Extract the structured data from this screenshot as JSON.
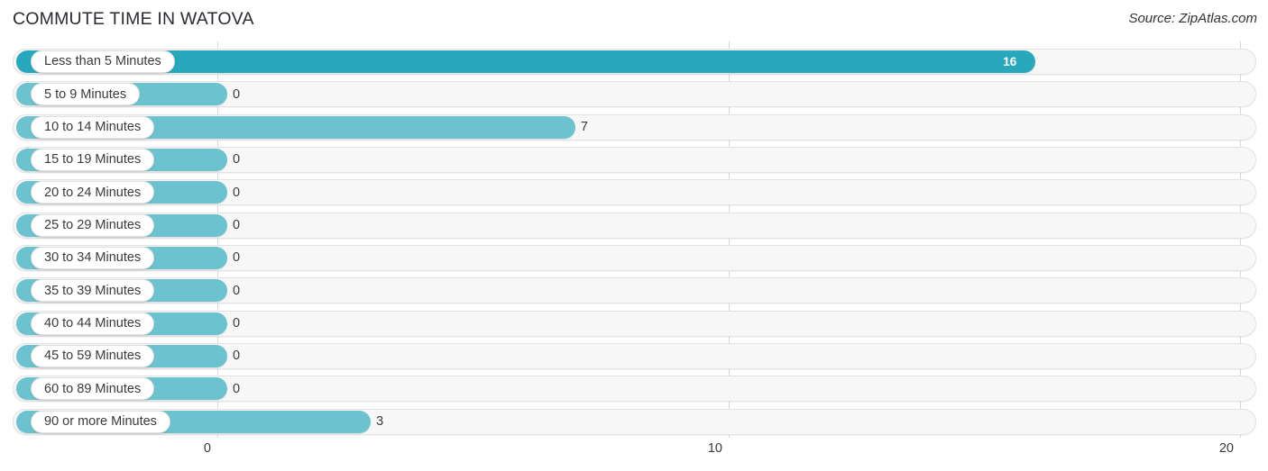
{
  "header": {
    "title": "COMMUTE TIME IN WATOVA",
    "source": "Source: ZipAtlas.com"
  },
  "colors": {
    "bar_highlight": "#29a8bc",
    "bar_normal": "#6cc2ce",
    "track_fill": "#f7f7f7",
    "track_border": "#e3e3e3",
    "gridline": "#d8d8d8",
    "label_text": "#3a3a3a",
    "value_inside_text": "#ffffff"
  },
  "chart_data": {
    "type": "bar",
    "orientation": "horizontal",
    "title": "COMMUTE TIME IN WATOVA",
    "subtitle": "",
    "xlabel": "",
    "ylabel": "",
    "xlim": [
      0,
      20
    ],
    "grid": true,
    "legend": "none",
    "ticks": [
      {
        "label": "0",
        "value": 0
      },
      {
        "label": "10",
        "value": 10
      },
      {
        "label": "20",
        "value": 20
      }
    ],
    "categories": [
      "Less than 5 Minutes",
      "5 to 9 Minutes",
      "10 to 14 Minutes",
      "15 to 19 Minutes",
      "20 to 24 Minutes",
      "25 to 29 Minutes",
      "30 to 34 Minutes",
      "35 to 39 Minutes",
      "40 to 44 Minutes",
      "45 to 59 Minutes",
      "60 to 89 Minutes",
      "90 or more Minutes"
    ],
    "values": [
      16,
      0,
      7,
      0,
      0,
      0,
      0,
      0,
      0,
      0,
      0,
      3
    ],
    "value_labels": [
      "16",
      "0",
      "7",
      "0",
      "0",
      "0",
      "0",
      "0",
      "0",
      "0",
      "0",
      "3"
    ]
  },
  "rows": [
    {
      "label": "Less than 5 Minutes",
      "value": 16,
      "value_label": "16",
      "highlight": true,
      "label_inside": true
    },
    {
      "label": "5 to 9 Minutes",
      "value": 0,
      "value_label": "0",
      "highlight": false,
      "label_inside": false
    },
    {
      "label": "10 to 14 Minutes",
      "value": 7,
      "value_label": "7",
      "highlight": false,
      "label_inside": false
    },
    {
      "label": "15 to 19 Minutes",
      "value": 0,
      "value_label": "0",
      "highlight": false,
      "label_inside": false
    },
    {
      "label": "20 to 24 Minutes",
      "value": 0,
      "value_label": "0",
      "highlight": false,
      "label_inside": false
    },
    {
      "label": "25 to 29 Minutes",
      "value": 0,
      "value_label": "0",
      "highlight": false,
      "label_inside": false
    },
    {
      "label": "30 to 34 Minutes",
      "value": 0,
      "value_label": "0",
      "highlight": false,
      "label_inside": false
    },
    {
      "label": "35 to 39 Minutes",
      "value": 0,
      "value_label": "0",
      "highlight": false,
      "label_inside": false
    },
    {
      "label": "40 to 44 Minutes",
      "value": 0,
      "value_label": "0",
      "highlight": false,
      "label_inside": false
    },
    {
      "label": "45 to 59 Minutes",
      "value": 0,
      "value_label": "0",
      "highlight": false,
      "label_inside": false
    },
    {
      "label": "60 to 89 Minutes",
      "value": 0,
      "value_label": "0",
      "highlight": false,
      "label_inside": false
    },
    {
      "label": "90 or more Minutes",
      "value": 3,
      "value_label": "3",
      "highlight": false,
      "label_inside": false
    }
  ]
}
